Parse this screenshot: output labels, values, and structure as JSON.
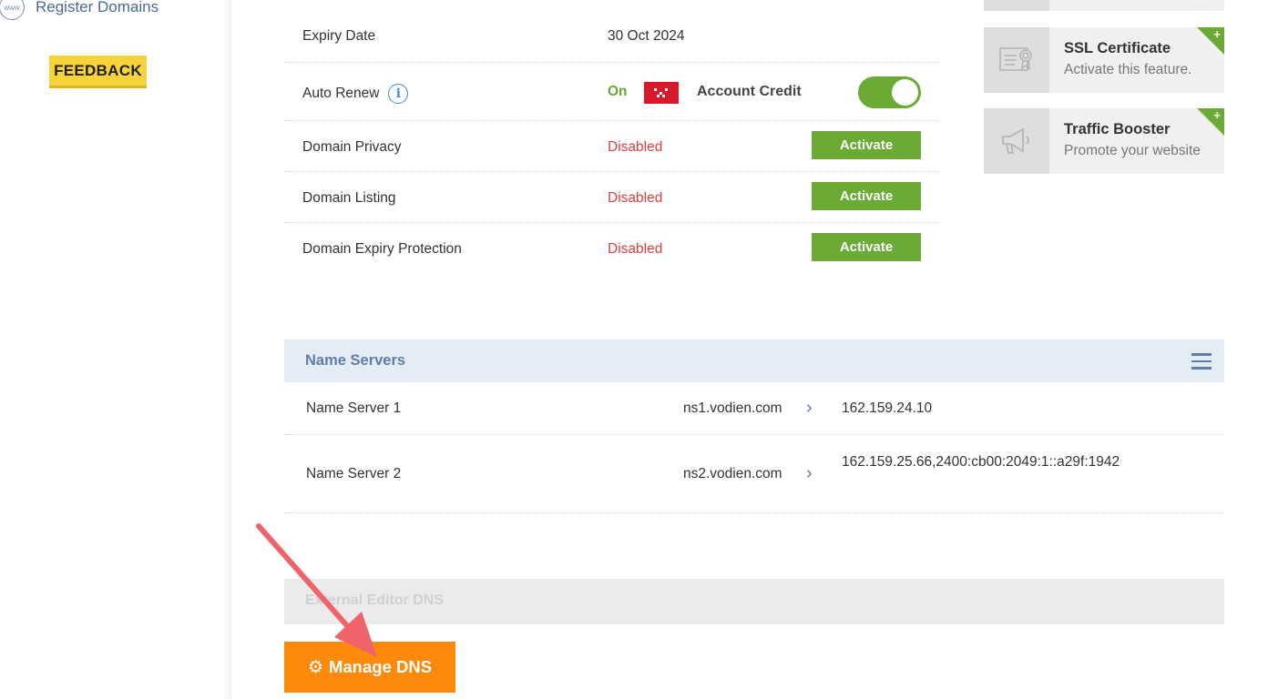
{
  "sidebar": {
    "register_domains": "Register Domains",
    "feedback": "FEEDBACK"
  },
  "details": {
    "expiry": {
      "label": "Expiry Date",
      "value": "30 Oct 2024"
    },
    "auto_renew": {
      "label": "Auto Renew",
      "status": "On",
      "method": "Account Credit",
      "toggle": "on"
    },
    "privacy": {
      "label": "Domain Privacy",
      "status": "Disabled",
      "button": "Activate"
    },
    "listing": {
      "label": "Domain Listing",
      "status": "Disabled",
      "button": "Activate"
    },
    "expiry_protection": {
      "label": "Domain Expiry Protection",
      "status": "Disabled",
      "button": "Activate"
    }
  },
  "cards": [
    {
      "title": "SSL Certificate",
      "subtitle": "Activate this feature.",
      "badge": "+"
    },
    {
      "title": "Traffic Booster",
      "subtitle": "Promote your website",
      "badge": "+"
    }
  ],
  "name_servers": {
    "header": "Name Servers",
    "rows": [
      {
        "label": "Name Server 1",
        "host": "ns1.vodien.com",
        "ip": "162.159.24.10"
      },
      {
        "label": "Name Server 2",
        "host": "ns2.vodien.com",
        "ip": "162.159.25.66,2400:cb00:2049:1::a29f:1942"
      }
    ]
  },
  "external_dns": "External Editor DNS",
  "manage_dns": "Manage DNS",
  "colors": {
    "accent_green": "#6aaa35",
    "orange": "#fd8a0b",
    "red": "#e04040",
    "annotation_arrow": "#f0636a"
  }
}
